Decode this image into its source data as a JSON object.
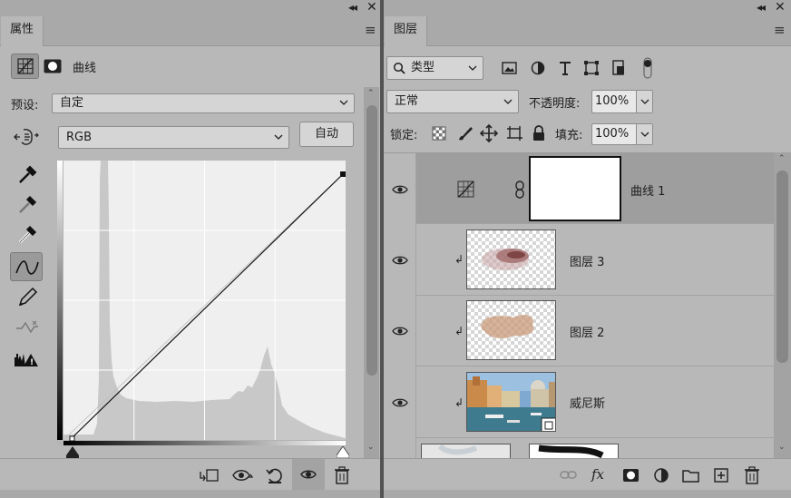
{
  "properties_panel": {
    "tab_label": "属性",
    "title": "曲线",
    "preset_label": "预设:",
    "preset_value": "自定",
    "channel_value": "RGB",
    "auto_button": "自动"
  },
  "layers_panel": {
    "tab_label": "图层",
    "filter_kind": "类型",
    "blend_mode": "正常",
    "opacity_label": "不透明度:",
    "opacity_value": "100%",
    "lock_label": "锁定:",
    "fill_label": "填充:",
    "fill_value": "100%",
    "layers": [
      {
        "name": "曲线 1",
        "type": "adjustment-curves",
        "selected": true
      },
      {
        "name": "图层 3",
        "type": "pixel",
        "clipped": true
      },
      {
        "name": "图层 2",
        "type": "pixel",
        "clipped": true
      },
      {
        "name": "威尼斯",
        "type": "smart-object",
        "clipped": true
      }
    ]
  },
  "colors": {
    "panel_bg": "#b8b8b8",
    "tab_strip": "#a9a9a9",
    "selected_row": "#9e9e9e",
    "curve_bg": "#efefef",
    "histogram": "#c8c8c8"
  }
}
